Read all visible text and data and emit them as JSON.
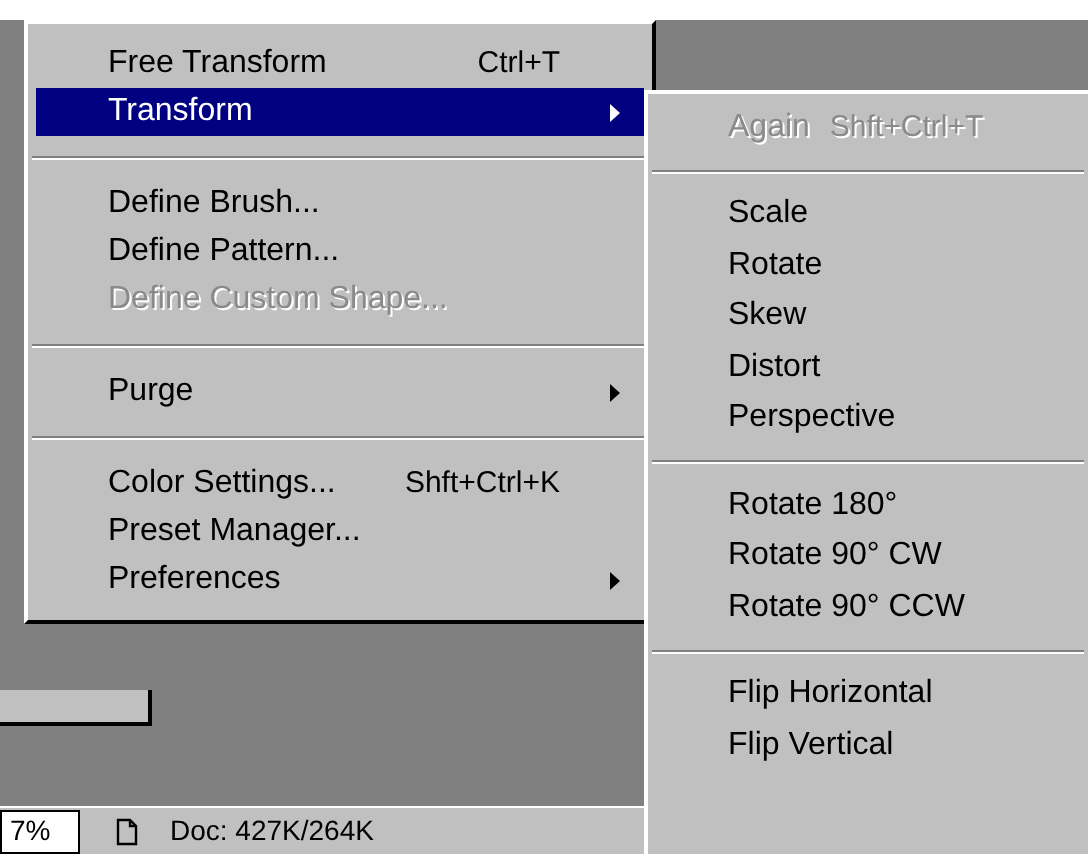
{
  "menu": {
    "items": [
      {
        "kind": "item",
        "label": "Free Transform",
        "shortcut": "Ctrl+T",
        "submenu": false,
        "selected": false,
        "disabled": false
      },
      {
        "kind": "item",
        "label": "Transform",
        "submenu": true,
        "selected": true,
        "disabled": false
      },
      {
        "kind": "separator"
      },
      {
        "kind": "item",
        "label": "Define Brush...",
        "submenu": false,
        "selected": false,
        "disabled": false
      },
      {
        "kind": "item",
        "label": "Define Pattern...",
        "submenu": false,
        "selected": false,
        "disabled": false
      },
      {
        "kind": "item",
        "label": "Define Custom Shape...",
        "submenu": false,
        "selected": false,
        "disabled": true
      },
      {
        "kind": "separator"
      },
      {
        "kind": "item",
        "label": "Purge",
        "submenu": true,
        "selected": false,
        "disabled": false
      },
      {
        "kind": "separator"
      },
      {
        "kind": "item",
        "label": "Color Settings...",
        "shortcut": "Shft+Ctrl+K",
        "submenu": false,
        "selected": false,
        "disabled": false
      },
      {
        "kind": "item",
        "label": "Preset Manager...",
        "submenu": false,
        "selected": false,
        "disabled": false
      },
      {
        "kind": "item",
        "label": "Preferences",
        "submenu": true,
        "selected": false,
        "disabled": false
      }
    ]
  },
  "submenu": {
    "items": [
      {
        "kind": "item",
        "label": "Again",
        "shortcut": "Shft+Ctrl+T",
        "disabled": true
      },
      {
        "kind": "separator"
      },
      {
        "kind": "item",
        "label": "Scale",
        "disabled": false
      },
      {
        "kind": "item",
        "label": "Rotate",
        "disabled": false
      },
      {
        "kind": "item",
        "label": "Skew",
        "disabled": false
      },
      {
        "kind": "item",
        "label": "Distort",
        "disabled": false
      },
      {
        "kind": "item",
        "label": "Perspective",
        "disabled": false
      },
      {
        "kind": "separator"
      },
      {
        "kind": "item",
        "label": "Rotate 180°",
        "disabled": false
      },
      {
        "kind": "item",
        "label": "Rotate 90° CW",
        "disabled": false
      },
      {
        "kind": "item",
        "label": "Rotate 90° CCW",
        "disabled": false
      },
      {
        "kind": "separator"
      },
      {
        "kind": "item",
        "label": "Flip Horizontal",
        "disabled": false
      },
      {
        "kind": "item",
        "label": "Flip Vertical",
        "disabled": false
      }
    ]
  },
  "status_bar": {
    "zoom": "7%",
    "doc_size": "Doc: 427K/264K"
  }
}
